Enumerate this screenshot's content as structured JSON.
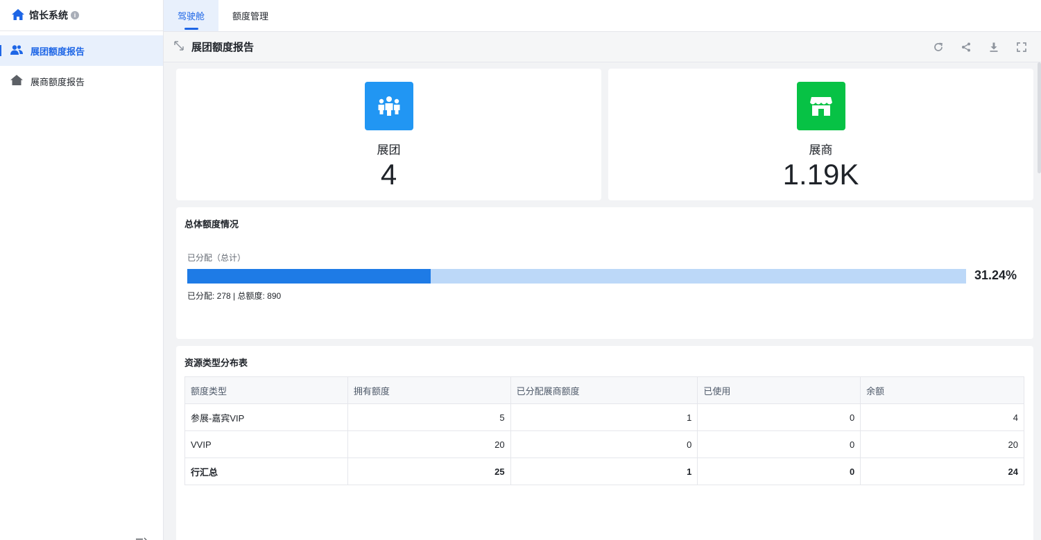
{
  "app": {
    "name": "馆长系统"
  },
  "sidebar": {
    "items": [
      {
        "label": "展团额度报告",
        "icon": "group-icon",
        "active": true
      },
      {
        "label": "展商额度报告",
        "icon": "home-icon",
        "active": false
      }
    ]
  },
  "tabs": [
    {
      "label": "驾驶舱",
      "active": true
    },
    {
      "label": "额度管理",
      "active": false
    }
  ],
  "page": {
    "title": "展团额度报告"
  },
  "stats": [
    {
      "label": "展团",
      "value": "4",
      "icon": "team-icon",
      "color": "#2196f3"
    },
    {
      "label": "展商",
      "value": "1.19K",
      "icon": "store-icon",
      "color": "#07c245"
    }
  ],
  "overall": {
    "title": "总体额度情况",
    "progress_label": "已分配（总计）",
    "percent_text": "31.24%",
    "percent_value": 31.24,
    "detail": "已分配: 278 | 总额度: 890"
  },
  "table": {
    "title": "资源类型分布表",
    "headers": [
      "额度类型",
      "拥有额度",
      "已分配展商额度",
      "已使用",
      "余额"
    ],
    "rows": [
      [
        "参展-嘉宾VIP",
        "5",
        "1",
        "0",
        "4"
      ],
      [
        "VVIP",
        "20",
        "0",
        "0",
        "20"
      ]
    ],
    "total": [
      "行汇总",
      "25",
      "1",
      "0",
      "24"
    ]
  },
  "colors": {
    "accent": "#1e66e6",
    "progress_fill": "#1e7be6",
    "progress_track": "#bcd8f8"
  }
}
